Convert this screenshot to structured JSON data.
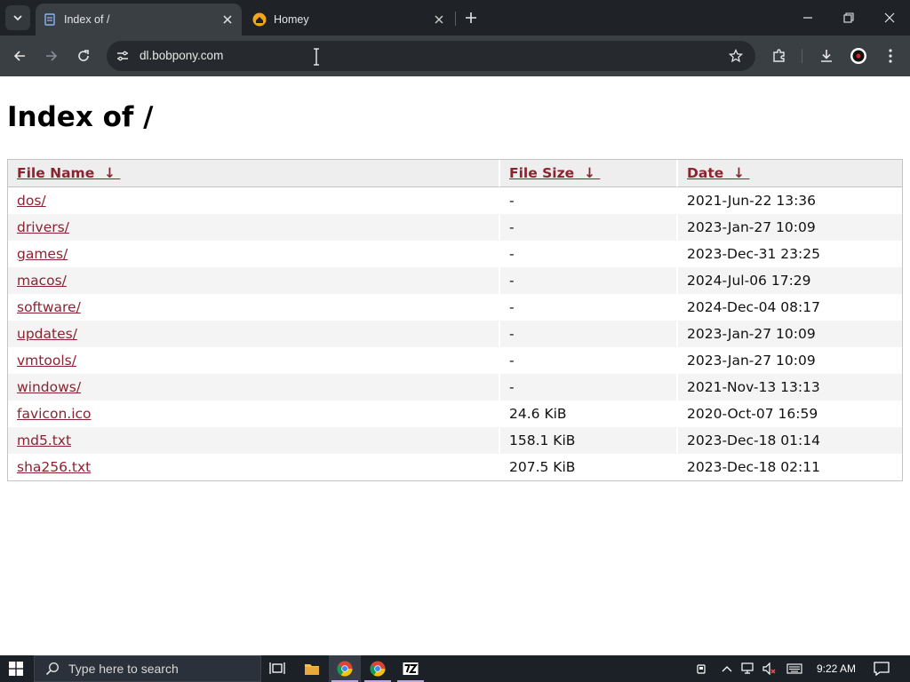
{
  "browser": {
    "tabs": [
      {
        "title": "Index of /",
        "active": true,
        "favicon": "page-icon"
      },
      {
        "title": "Homey",
        "active": false,
        "favicon": "homey-icon"
      }
    ],
    "url": "dl.bobpony.com",
    "accent": "#3a3f44"
  },
  "page": {
    "heading": "Index of /",
    "columns": [
      {
        "label": "File Name",
        "sort": "↓"
      },
      {
        "label": "File Size",
        "sort": "↓"
      },
      {
        "label": "Date",
        "sort": "↓"
      }
    ],
    "rows": [
      {
        "name": "dos/",
        "size": "-",
        "date": "2021-Jun-22 13:36"
      },
      {
        "name": "drivers/",
        "size": "-",
        "date": "2023-Jan-27 10:09"
      },
      {
        "name": "games/",
        "size": "-",
        "date": "2023-Dec-31 23:25"
      },
      {
        "name": "macos/",
        "size": "-",
        "date": "2024-Jul-06 17:29"
      },
      {
        "name": "software/",
        "size": "-",
        "date": "2024-Dec-04 08:17"
      },
      {
        "name": "updates/",
        "size": "-",
        "date": "2023-Jan-27 10:09"
      },
      {
        "name": "vmtools/",
        "size": "-",
        "date": "2023-Jan-27 10:09"
      },
      {
        "name": "windows/",
        "size": "-",
        "date": "2021-Nov-13 13:13"
      },
      {
        "name": "favicon.ico",
        "size": "24.6 KiB",
        "date": "2020-Oct-07 16:59"
      },
      {
        "name": "md5.txt",
        "size": "158.1 KiB",
        "date": "2023-Dec-18 01:14"
      },
      {
        "name": "sha256.txt",
        "size": "207.5 KiB",
        "date": "2023-Dec-18 02:11"
      }
    ],
    "link_color": "#8b2331"
  },
  "taskbar": {
    "search_placeholder": "Type here to search",
    "time": "9:22 AM",
    "apps": [
      "task-view-icon",
      "file-explorer-icon",
      "chrome-icon",
      "chrome-alt-icon",
      "7zip-icon"
    ]
  }
}
